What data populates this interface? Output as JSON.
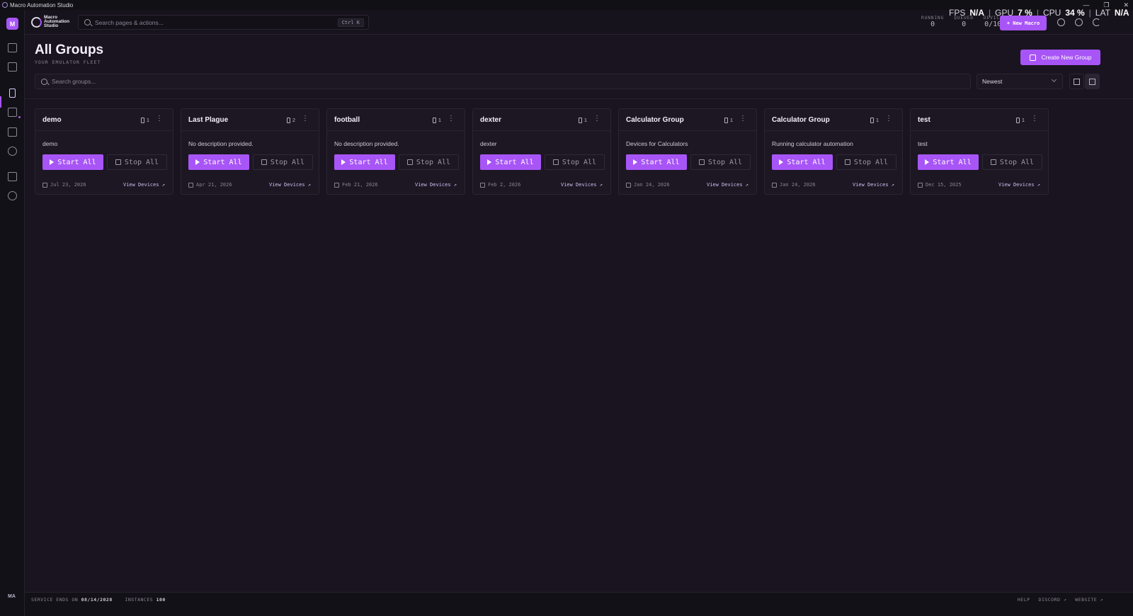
{
  "window": {
    "title": "Macro Automation Studio",
    "controls": [
      "—",
      "❐",
      "✕"
    ]
  },
  "sidebar": {
    "avatar": "M",
    "footer": "MA"
  },
  "topbar": {
    "logo_line1": "Macro",
    "logo_line2": "Automation",
    "logo_line3": "Studio",
    "search_placeholder": "Search pages & actions...",
    "search_shortcut": "Ctrl K",
    "stats": {
      "running_label": "RUNNING",
      "running_value": "0",
      "queued_label": "QUEUED",
      "queued_value": "0",
      "devices_label": "DEVICES",
      "devices_value": "0/100"
    },
    "perf": {
      "fps_label": "FPS",
      "fps_value": "N/A",
      "gpu_label": "GPU",
      "gpu_value": "7 %",
      "cpu_label": "CPU",
      "cpu_value": "34 %",
      "lat_label": "LAT",
      "lat_value": "N/A"
    },
    "new_macro_label": "+ New Macro"
  },
  "page": {
    "title": "All Groups",
    "subtitle": "YOUR EMULATOR FLEET",
    "create_button": "Create New Group",
    "search_placeholder": "Search groups...",
    "sort_value": "Newest"
  },
  "groups": [
    {
      "name": "demo",
      "count": "1",
      "description": "demo",
      "start": "Start All",
      "stop": "Stop All",
      "date": "Jul 23, 2026",
      "link": "View Devices ↗"
    },
    {
      "name": "Last Plague",
      "count": "2",
      "description": "No description provided.",
      "start": "Start All",
      "stop": "Stop All",
      "date": "Apr 21, 2026",
      "link": "View Devices ↗"
    },
    {
      "name": "football",
      "count": "1",
      "description": "No description provided.",
      "start": "Start All",
      "stop": "Stop All",
      "date": "Feb 21, 2026",
      "link": "View Devices ↗"
    },
    {
      "name": "dexter",
      "count": "1",
      "description": "dexter",
      "start": "Start All",
      "stop": "Stop All",
      "date": "Feb 2, 2026",
      "link": "View Devices ↗"
    },
    {
      "name": "Calculator Group",
      "count": "1",
      "description": "Devices for Calculators",
      "start": "Start All",
      "stop": "Stop All",
      "date": "Jan 24, 2026",
      "link": "View Devices ↗"
    },
    {
      "name": "Calculator Group",
      "count": "1",
      "description": "Running calculator automation",
      "start": "Start All",
      "stop": "Stop All",
      "date": "Jan 24, 2026",
      "link": "View Devices ↗"
    },
    {
      "name": "test",
      "count": "1",
      "description": "test",
      "start": "Start All",
      "stop": "Stop All",
      "date": "Dec 15, 2025",
      "link": "View Devices ↗"
    }
  ],
  "statusbar": {
    "service_label": "SERVICE ENDS ON",
    "service_date": "08/14/2028",
    "instances_label": "INSTANCES",
    "instances_value": "100",
    "help": "HELP",
    "discord": "DISCORD ↗",
    "website": "WEBSITE ↗"
  }
}
